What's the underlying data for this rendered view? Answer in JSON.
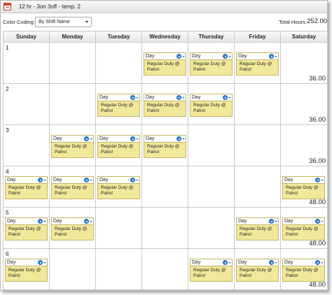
{
  "window": {
    "title": "12 hr - 3on 3off - temp. 2"
  },
  "toolbar": {
    "color_coding_label": "Color Coding:",
    "color_coding_value": "By Shift Name",
    "total_hours_label": "Total Hours:",
    "total_hours_value": "252.00"
  },
  "days": [
    "Sunday",
    "Monday",
    "Tuesday",
    "Wednesday",
    "Thursday",
    "Friday",
    "Saturday"
  ],
  "shift_template": {
    "name": "Day",
    "detail": "Regular Duty @ Patrol"
  },
  "weeks": [
    {
      "number": "1",
      "total": "36.00",
      "shifts": [
        false,
        false,
        false,
        true,
        true,
        true,
        false
      ]
    },
    {
      "number": "2",
      "total": "36.00",
      "shifts": [
        false,
        false,
        true,
        true,
        true,
        false,
        false
      ]
    },
    {
      "number": "3",
      "total": "36.00",
      "shifts": [
        false,
        true,
        true,
        true,
        false,
        false,
        false
      ]
    },
    {
      "number": "4",
      "total": "48.00",
      "shifts": [
        true,
        true,
        true,
        false,
        false,
        false,
        true
      ]
    },
    {
      "number": "5",
      "total": "48.00",
      "shifts": [
        true,
        true,
        false,
        false,
        false,
        true,
        true
      ]
    },
    {
      "number": "6",
      "total": "48.00",
      "shifts": [
        true,
        false,
        false,
        false,
        true,
        true,
        true
      ]
    }
  ],
  "icons": {
    "calendar": "calendar-icon",
    "gear": "gear-icon",
    "dropdown": "chevron-down-icon"
  },
  "colors": {
    "shift_fill": "#f1e89a",
    "shift_border": "#c2b469",
    "gear_blue": "#2f7fd0"
  }
}
